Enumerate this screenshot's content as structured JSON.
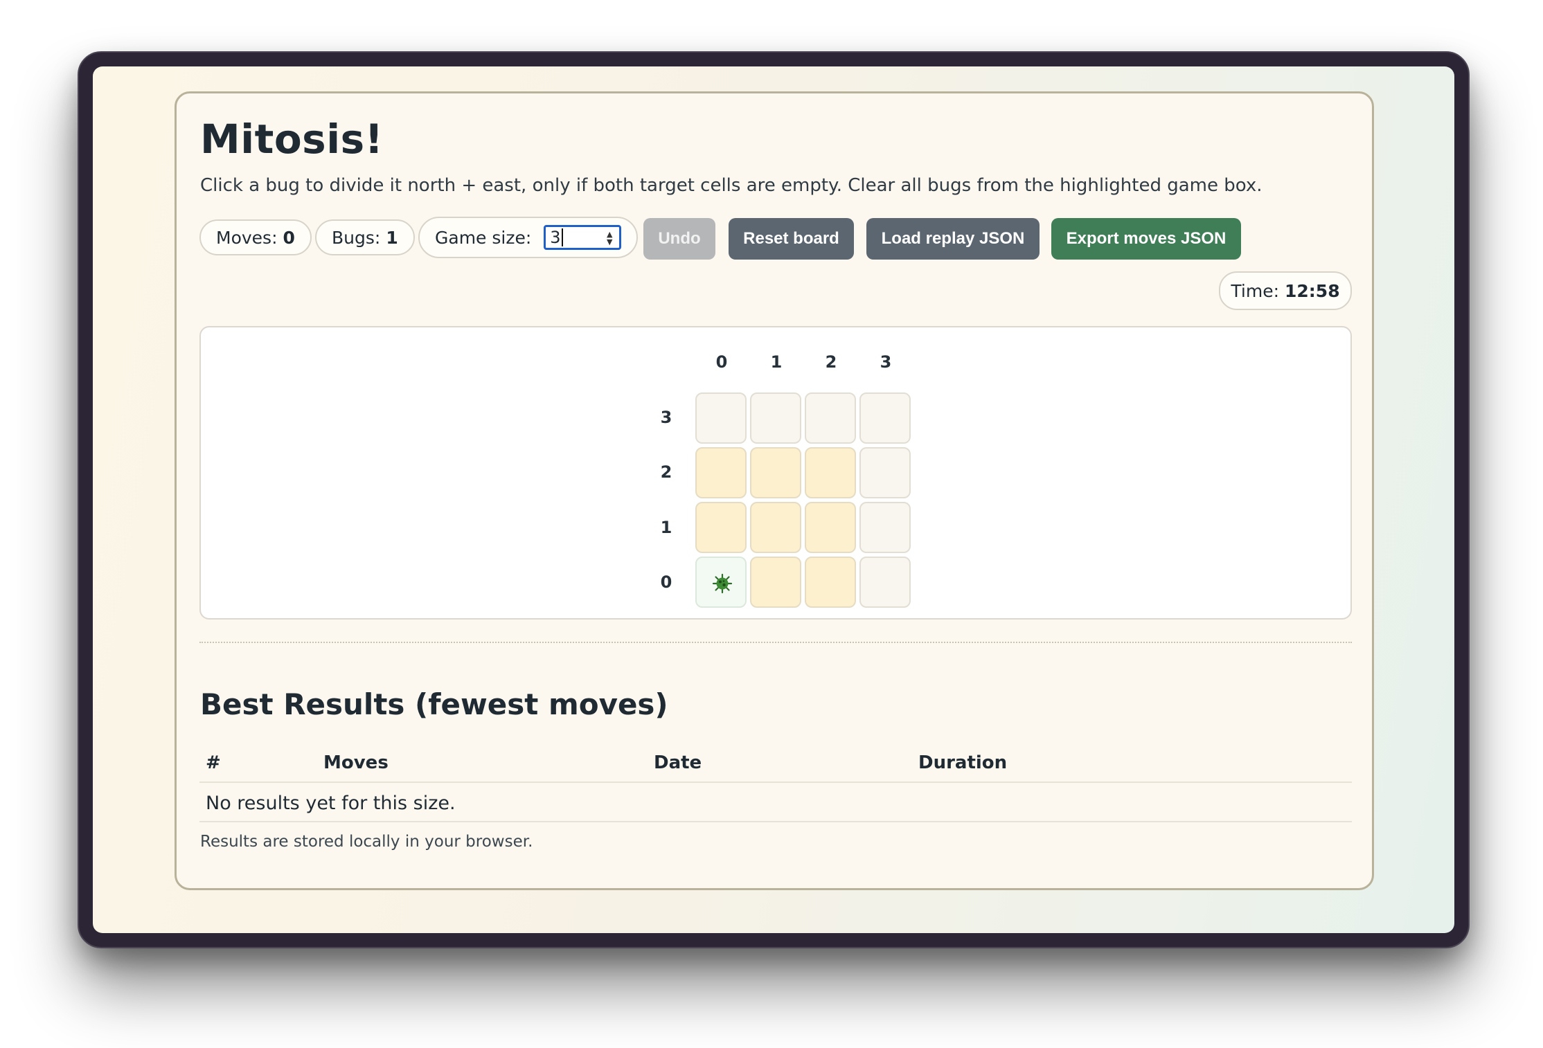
{
  "title": "Mitosis!",
  "instructions": "Click a bug to divide it north + east, only if both target cells are empty. Clear all bugs from the highlighted game box.",
  "stats": {
    "moves_label": "Moves:",
    "moves_value": "0",
    "bugs_label": "Bugs:",
    "bugs_value": "1",
    "size_label": "Game size:",
    "size_value": "3",
    "time_label": "Time:",
    "time_value": "12:58"
  },
  "buttons": {
    "undo": "Undo",
    "reset": "Reset board",
    "load": "Load replay JSON",
    "export": "Export moves JSON"
  },
  "board": {
    "columns": [
      "0",
      "1",
      "2",
      "3"
    ],
    "rows": [
      "3",
      "2",
      "1",
      "0"
    ],
    "highlight_box_size": 3,
    "bugs": [
      {
        "col": 0,
        "row": 0
      }
    ],
    "bug_icon": "microbe-icon"
  },
  "results": {
    "heading": "Best Results (fewest moves)",
    "columns": [
      "#",
      "Moves",
      "Date",
      "Duration"
    ],
    "empty_message": "No results yet for this size.",
    "note": "Results are stored locally in your browser."
  },
  "colors": {
    "accent_green": "#3f7e57",
    "button_gray": "#5b6670",
    "highlight_cell": "#fdf0ce"
  }
}
